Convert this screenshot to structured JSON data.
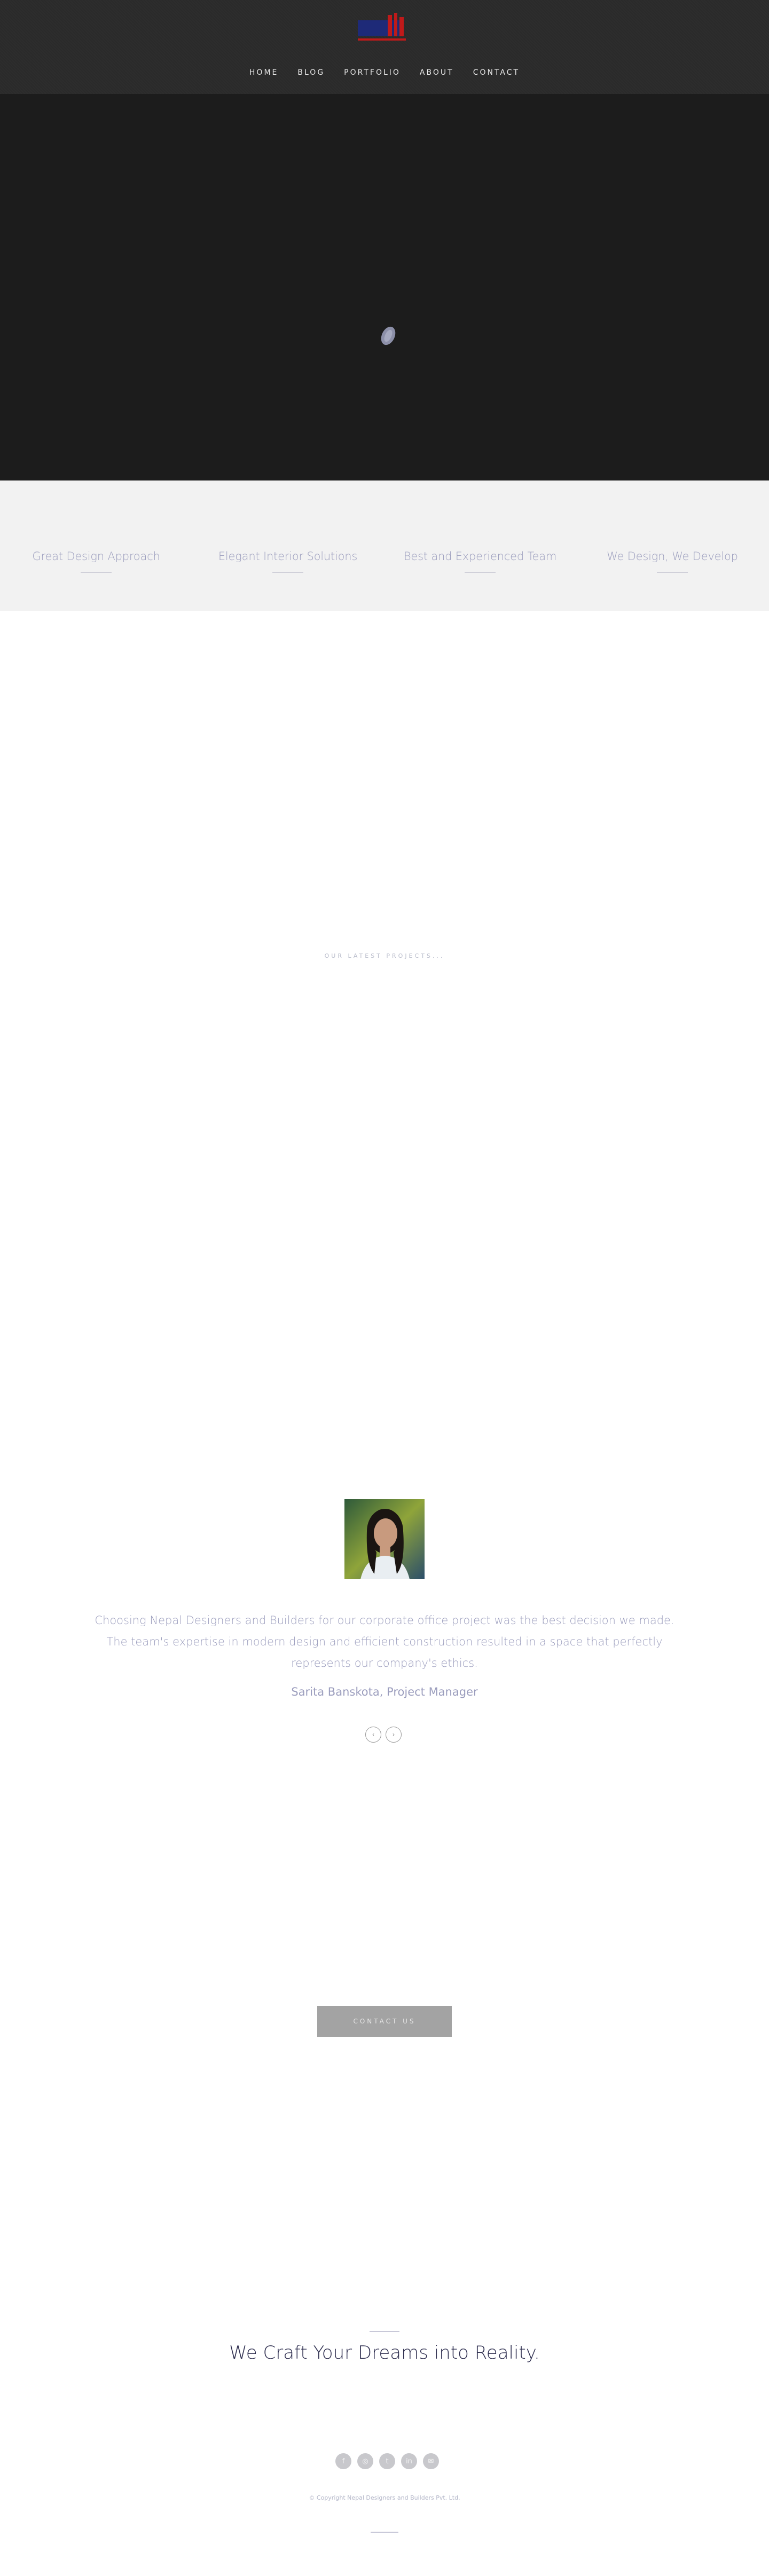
{
  "header": {
    "logo": "company-logo",
    "nav": [
      {
        "label": "HOME"
      },
      {
        "label": "BLOG"
      },
      {
        "label": "PORTFOLIO"
      },
      {
        "label": "ABOUT"
      },
      {
        "label": "CONTACT"
      }
    ]
  },
  "hero": {
    "loader": "loading-spinner-icon"
  },
  "features": [
    {
      "title": "Great Design Approach"
    },
    {
      "title": "Elegant Interior Solutions"
    },
    {
      "title": "Best and Experienced Team"
    },
    {
      "title": "We Design, We Develop"
    }
  ],
  "projects": {
    "heading": "OUR LATEST PROJECTS..."
  },
  "testimonial": {
    "quote": "Choosing Nepal Designers and Builders for our corporate office project was the best decision we made. The team's expertise in modern design and efficient construction resulted in a space that perfectly represents our company's ethics.",
    "author": "Sarita Banskota, Project Manager",
    "prev_icon": "chevron-left-icon",
    "next_icon": "chevron-right-icon"
  },
  "cta": {
    "label": "CONTACT US"
  },
  "motto": {
    "text": "We Craft Your Dreams into Reality."
  },
  "footer": {
    "socials": [
      "facebook-icon",
      "instagram-icon",
      "twitter-icon",
      "linkedin-icon",
      "email-icon"
    ],
    "copyright": "© Copyright Nepal Designers and Builders Pvt. Ltd."
  },
  "colors": {
    "header_bg": "#2b2b2b",
    "hero_bg": "#1c1c1c",
    "accent_text": "#9b9dbd",
    "cta_bg": "#a3a3a3"
  }
}
